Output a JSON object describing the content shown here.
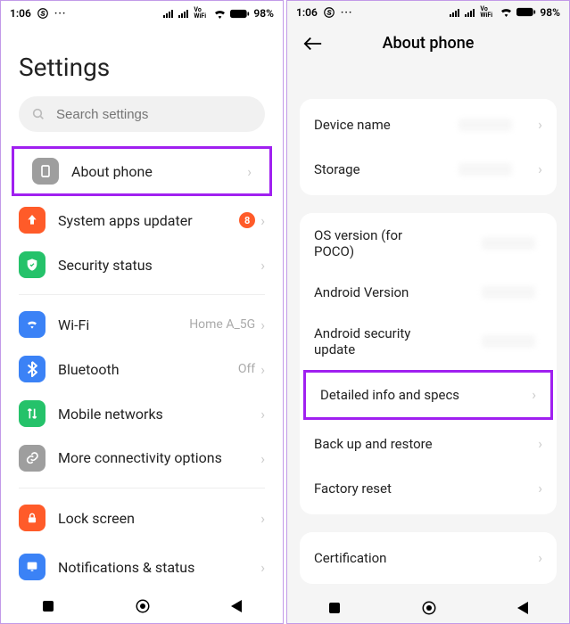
{
  "statusbar": {
    "time": "1:06",
    "battery_pct": "98%",
    "vowifi": "Vo WiFi"
  },
  "left": {
    "title": "Settings",
    "search_placeholder": "Search settings",
    "items": [
      {
        "label": "About phone",
        "icon_bg": "#9e9e9e"
      },
      {
        "label": "System apps updater",
        "icon_bg": "#ff5b29",
        "badge": "8"
      },
      {
        "label": "Security status",
        "icon_bg": "#25c26a"
      },
      {
        "label": "Wi-Fi",
        "icon_bg": "#3b82f6",
        "value": "Home A_5G"
      },
      {
        "label": "Bluetooth",
        "icon_bg": "#3b82f6",
        "value": "Off"
      },
      {
        "label": "Mobile networks",
        "icon_bg": "#25c26a"
      },
      {
        "label": "More connectivity options",
        "icon_bg": "#9e9e9e"
      },
      {
        "label": "Lock screen",
        "icon_bg": "#ff5b29"
      },
      {
        "label": "Notifications & status",
        "icon_bg": "#3b82f6"
      }
    ]
  },
  "right": {
    "title": "About phone",
    "card1": [
      {
        "label": "Device name"
      },
      {
        "label": "Storage"
      }
    ],
    "card2": [
      {
        "label": "OS version (for POCO)"
      },
      {
        "label": "Android Version"
      },
      {
        "label": "Android security update"
      },
      {
        "label": "Detailed info and specs",
        "highlight": true
      },
      {
        "label": "Back up and restore"
      },
      {
        "label": "Factory reset"
      }
    ],
    "card3": [
      {
        "label": "Certification"
      }
    ]
  }
}
